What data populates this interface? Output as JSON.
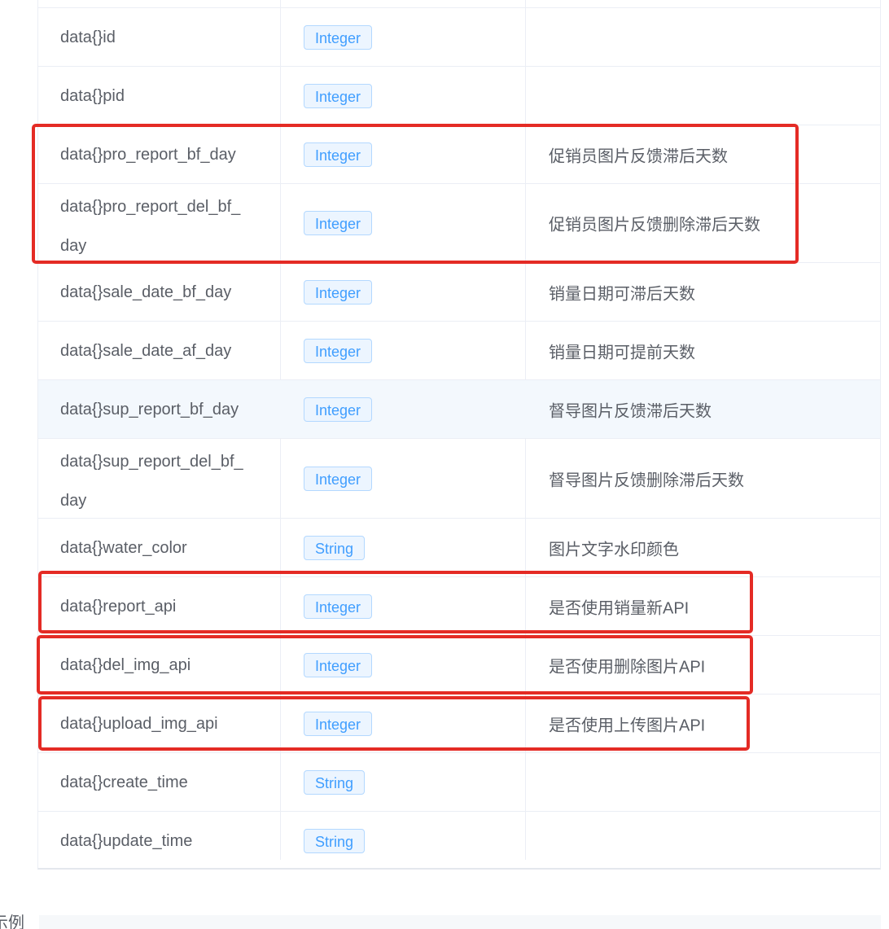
{
  "rows": [
    {
      "name": "data{}id",
      "type": "Integer",
      "desc": ""
    },
    {
      "name": "data{}pid",
      "type": "Integer",
      "desc": ""
    },
    {
      "name": "data{}pro_report_bf_day",
      "type": "Integer",
      "desc": "促销员图片反馈滞后天数"
    },
    {
      "name_line1": "data{}pro_report_del_bf_",
      "name_line2": "day",
      "type": "Integer",
      "desc": "促销员图片反馈删除滞后天数"
    },
    {
      "name": "data{}sale_date_bf_day",
      "type": "Integer",
      "desc": "销量日期可滞后天数"
    },
    {
      "name": "data{}sale_date_af_day",
      "type": "Integer",
      "desc": "销量日期可提前天数"
    },
    {
      "name": "data{}sup_report_bf_day",
      "type": "Integer",
      "desc": "督导图片反馈滞后天数"
    },
    {
      "name_line1": "data{}sup_report_del_bf_",
      "name_line2": "day",
      "type": "Integer",
      "desc": "督导图片反馈删除滞后天数"
    },
    {
      "name": "data{}water_color",
      "type": "String",
      "desc": "图片文字水印颜色"
    },
    {
      "name": "data{}report_api",
      "type": "Integer",
      "desc": "是否使用销量新API"
    },
    {
      "name": "data{}del_img_api",
      "type": "Integer",
      "desc": "是否使用删除图片API"
    },
    {
      "name": "data{}upload_img_api",
      "type": "Integer",
      "desc": "是否使用上传图片API"
    },
    {
      "name": "data{}create_time",
      "type": "String",
      "desc": ""
    },
    {
      "name": "data{}update_time",
      "type": "String",
      "desc": ""
    }
  ],
  "example_label": "示例",
  "colors": {
    "highlight_box": "#e42b25",
    "tag_text": "#409eff",
    "tag_bg": "#ecf5ff",
    "hover_row": "#f3f8fd"
  }
}
